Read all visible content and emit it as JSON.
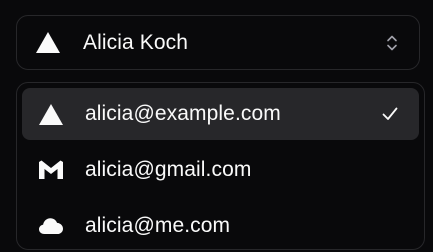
{
  "account_select": {
    "selected_label": "Alicia Koch",
    "selected_icon": "vercel-triangle-icon",
    "trigger_icon": "chevrons-up-down-icon",
    "options": [
      {
        "label": "alicia@example.com",
        "icon": "vercel-triangle-icon",
        "selected": true
      },
      {
        "label": "alicia@gmail.com",
        "icon": "gmail-icon",
        "selected": false
      },
      {
        "label": "alicia@me.com",
        "icon": "icloud-icon",
        "selected": false
      }
    ],
    "selected_marker_icon": "check-icon"
  },
  "colors": {
    "background": "#09090b",
    "border": "#27272a",
    "highlight": "#27272a",
    "text": "#fafafa",
    "muted": "#a1a1aa"
  }
}
